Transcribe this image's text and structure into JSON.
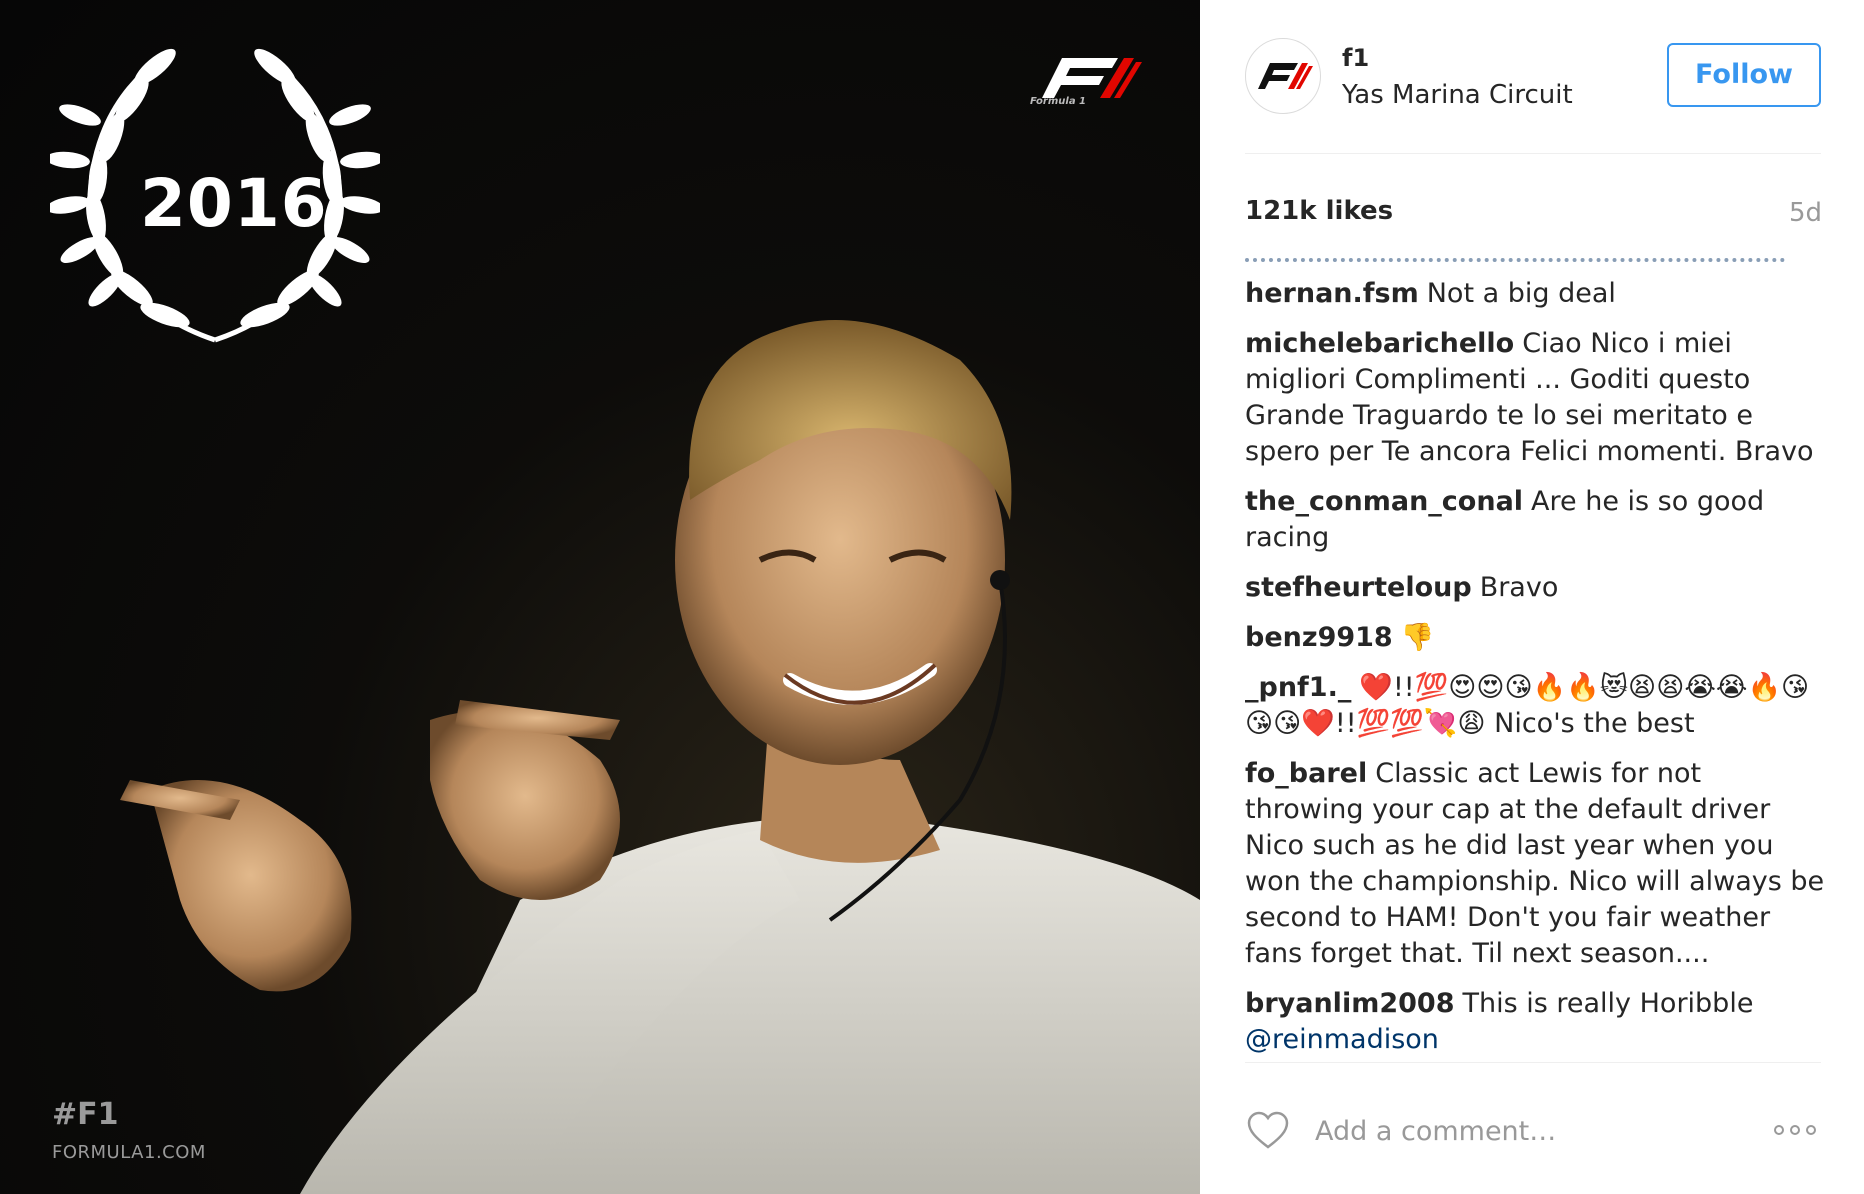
{
  "photo": {
    "year": "2016",
    "hashtag": "#F1",
    "site": "FORMULA1.COM",
    "logo_caption": "Formula 1"
  },
  "post": {
    "username": "f1",
    "location": "Yas Marina Circuit",
    "follow_label": "Follow",
    "likes": "121k likes",
    "time": "5d",
    "avatar_icon": "f1-logo-icon"
  },
  "comments": [
    {
      "user": "hernan.fsm",
      "text": "Not a big deal"
    },
    {
      "user": "michelebarichello",
      "text": "Ciao Nico i miei migliori Complimenti ... Goditi questo Grande Traguardo te lo sei meritato e spero per Te ancora Felici momenti. Bravo"
    },
    {
      "user": "the_conman_conal",
      "text": "Are he is so good racing"
    },
    {
      "user": "stefheurteloup",
      "text": "Bravo"
    },
    {
      "user": "benz9918",
      "text": "👎"
    },
    {
      "user": "_pnf1._",
      "text": "❤️!!💯😍😍😘🔥🔥😻😫😫😭😭🔥😘😘😘❤️!!💯💯💘😩 Nico's the best"
    },
    {
      "user": "fo_barel",
      "text": "Classic act Lewis for not throwing your cap at the default driver Nico such as he did last year when you won the championship. Nico will always be second to HAM! Don't you fair weather fans forget that. Til next season...."
    },
    {
      "user": "bryanlim2008",
      "text": "This is really Horibble",
      "mention": "@reinmadison"
    }
  ],
  "footer": {
    "comment_placeholder": "Add a comment…",
    "like_icon": "heart-icon",
    "more_icon": "more-options-icon"
  },
  "colors": {
    "accent": "#3897f0",
    "text": "#262626",
    "muted": "#999999"
  }
}
